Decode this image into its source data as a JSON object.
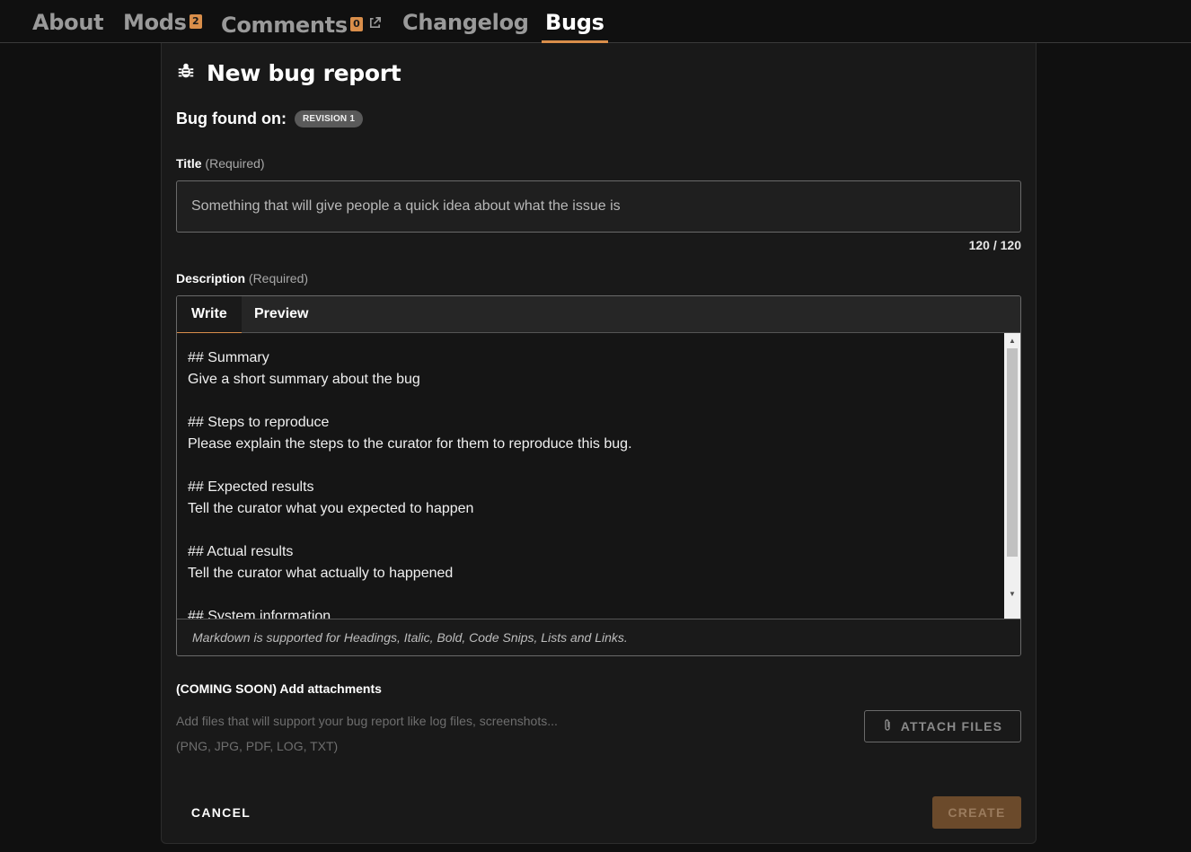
{
  "nav": {
    "tabs": [
      {
        "label": "About"
      },
      {
        "label": "Mods",
        "badge": "2"
      },
      {
        "label": "Comments",
        "badge": "0"
      },
      {
        "label": "Changelog"
      },
      {
        "label": "Bugs"
      }
    ],
    "active": "Bugs"
  },
  "form": {
    "heading": "New bug report",
    "bug_found_label": "Bug found on:",
    "revision_pill": "REVISION 1",
    "title": {
      "label": "Title",
      "required": "(Required)",
      "placeholder": "Something that will give people a quick idea about what the issue is",
      "value": "",
      "counter": "120 / 120"
    },
    "description": {
      "label": "Description",
      "required": "(Required)",
      "tab_write": "Write",
      "tab_preview": "Preview",
      "value": "## Summary\nGive a short summary about the bug\n\n## Steps to reproduce\nPlease explain the steps to the curator for them to reproduce this bug.\n\n## Expected results\nTell the curator what you expected to happen\n\n## Actual results\nTell the curator what actually to happened\n\n## System information",
      "footer_note": "Markdown is supported for Headings, Italic, Bold, Code Snips, Lists and Links."
    },
    "attachments": {
      "title": "(COMING SOON) Add attachments",
      "description": "Add files that will support your bug report like log files, screenshots...",
      "types": "(PNG, JPG, PDF, LOG, TXT)",
      "button_label": "ATTACH FILES"
    },
    "cancel_label": "CANCEL",
    "create_label": "CREATE"
  },
  "colors": {
    "accent": "#d98e4a",
    "background": "#101010",
    "panel": "#191919"
  },
  "icons": [
    "bug-icon",
    "external-link-icon",
    "paperclip-icon"
  ]
}
